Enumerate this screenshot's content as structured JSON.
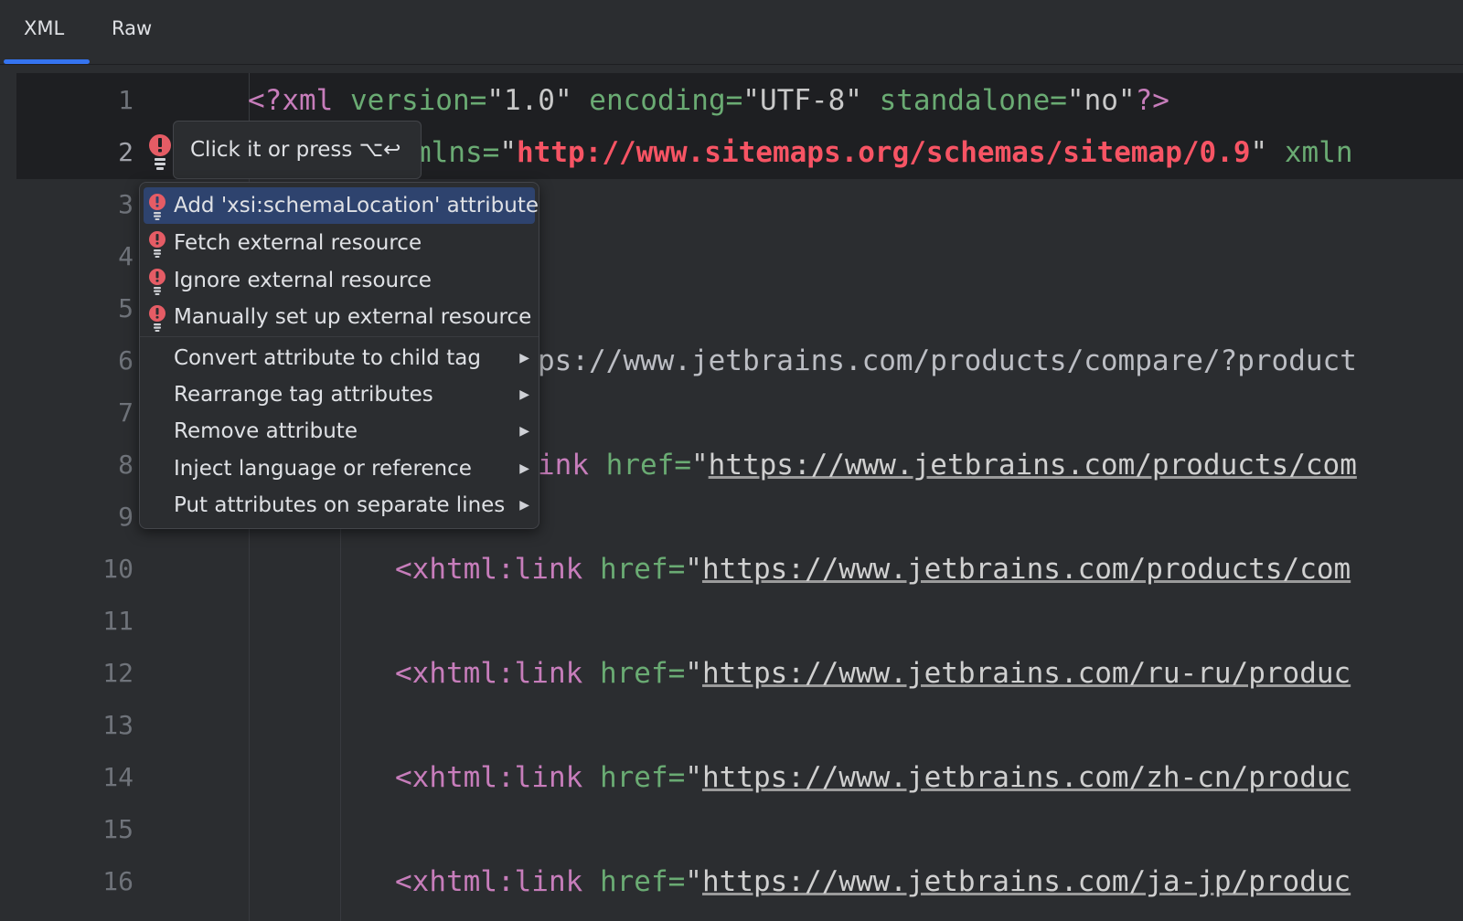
{
  "tabs": [
    {
      "label": "XML",
      "active": true
    },
    {
      "label": "Raw",
      "active": false
    }
  ],
  "gutter": {
    "line_numbers": [
      "1",
      "2",
      "3",
      "4",
      "5",
      "6",
      "7",
      "8",
      "9",
      "10",
      "11",
      "12",
      "13",
      "14",
      "15",
      "16"
    ],
    "active_line": "2"
  },
  "code": {
    "line1": {
      "open": "<?",
      "name": "xml",
      "attr1": " version=",
      "val1": "\"1.0\"",
      "attr2": " encoding=",
      "val2": "\"UTF-8\"",
      "attr3": " standalone=",
      "val3": "\"no\"",
      "close": "?>"
    },
    "line2": {
      "attr": "mlns=",
      "quote_open": "\"",
      "url": "http://www.sitemaps.org/schemas/sitemap/0.9",
      "quote_close": "\"",
      "next": " xmln"
    },
    "line6": {
      "url_fragment": "ps://www.jetbrains.com/products/compare/?product"
    },
    "line8": {
      "tag_fragment": "ink",
      "attr": " href=",
      "quote": "\"",
      "url": "https://www.jetbrains.com/products/com"
    },
    "line10": {
      "tag": "<xhtml:link",
      "attr": " href=",
      "quote": "\"",
      "url": "https://www.jetbrains.com/products/com"
    },
    "line12": {
      "tag": "<xhtml:link",
      "attr": " href=",
      "quote": "\"",
      "url": "https://www.jetbrains.com/ru-ru/produc"
    },
    "line14": {
      "tag": "<xhtml:link",
      "attr": " href=",
      "quote": "\"",
      "url": "https://www.jetbrains.com/zh-cn/produc"
    },
    "line16": {
      "tag": "<xhtml:link",
      "attr": " href=",
      "quote": "\"",
      "url": "https://www.jetbrains.com/ja-jp/produc"
    }
  },
  "hint": {
    "text": "Click it or press ⌥↩"
  },
  "intention_menu": {
    "items": [
      {
        "label": "Add 'xsi:schemaLocation' attribute",
        "icon": "error-bulb-icon",
        "submenu": false,
        "selected": true
      },
      {
        "label": "Fetch external resource",
        "icon": "error-bulb-icon",
        "submenu": false,
        "selected": false
      },
      {
        "label": "Ignore external resource",
        "icon": "error-bulb-icon",
        "submenu": false,
        "selected": false
      },
      {
        "label": "Manually set up external resource",
        "icon": "error-bulb-icon",
        "submenu": false,
        "selected": false
      },
      {
        "label": "Convert attribute to child tag",
        "icon": "",
        "submenu": true,
        "selected": false
      },
      {
        "label": "Rearrange tag attributes",
        "icon": "",
        "submenu": true,
        "selected": false
      },
      {
        "label": "Remove attribute",
        "icon": "",
        "submenu": true,
        "selected": false
      },
      {
        "label": "Inject language or reference",
        "icon": "",
        "submenu": true,
        "selected": false
      },
      {
        "label": "Put attributes on separate lines",
        "icon": "",
        "submenu": true,
        "selected": false
      }
    ]
  },
  "colors": {
    "accent": "#3574f0",
    "error": "#e55c65",
    "selection": "#2e436e"
  }
}
